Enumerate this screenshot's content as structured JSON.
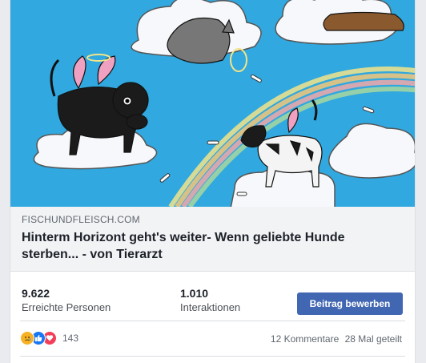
{
  "link_preview": {
    "domain": "FISCHUNDFLEISCH.COM",
    "headline": "Hinterm Horizont geht's weiter- Wenn geliebte Hunde sterben... - von Tierarzt"
  },
  "stats": {
    "reach": {
      "value": "9.622",
      "label": "Erreichte Personen"
    },
    "engagement": {
      "value": "1.010",
      "label": "Interaktionen"
    }
  },
  "boost_button_label": "Beitrag bewerben",
  "reactions": {
    "icons": [
      "sad-icon",
      "like-icon",
      "love-icon"
    ],
    "count": "143"
  },
  "comments_label": "12 Kommentare",
  "shares_label": "28 Mal geteilt",
  "colors": {
    "sky": "#2aa3dc",
    "brand_button": "#4267b2",
    "like": "#1877f2",
    "love": "#f33e58",
    "sad": "#f7b125"
  }
}
